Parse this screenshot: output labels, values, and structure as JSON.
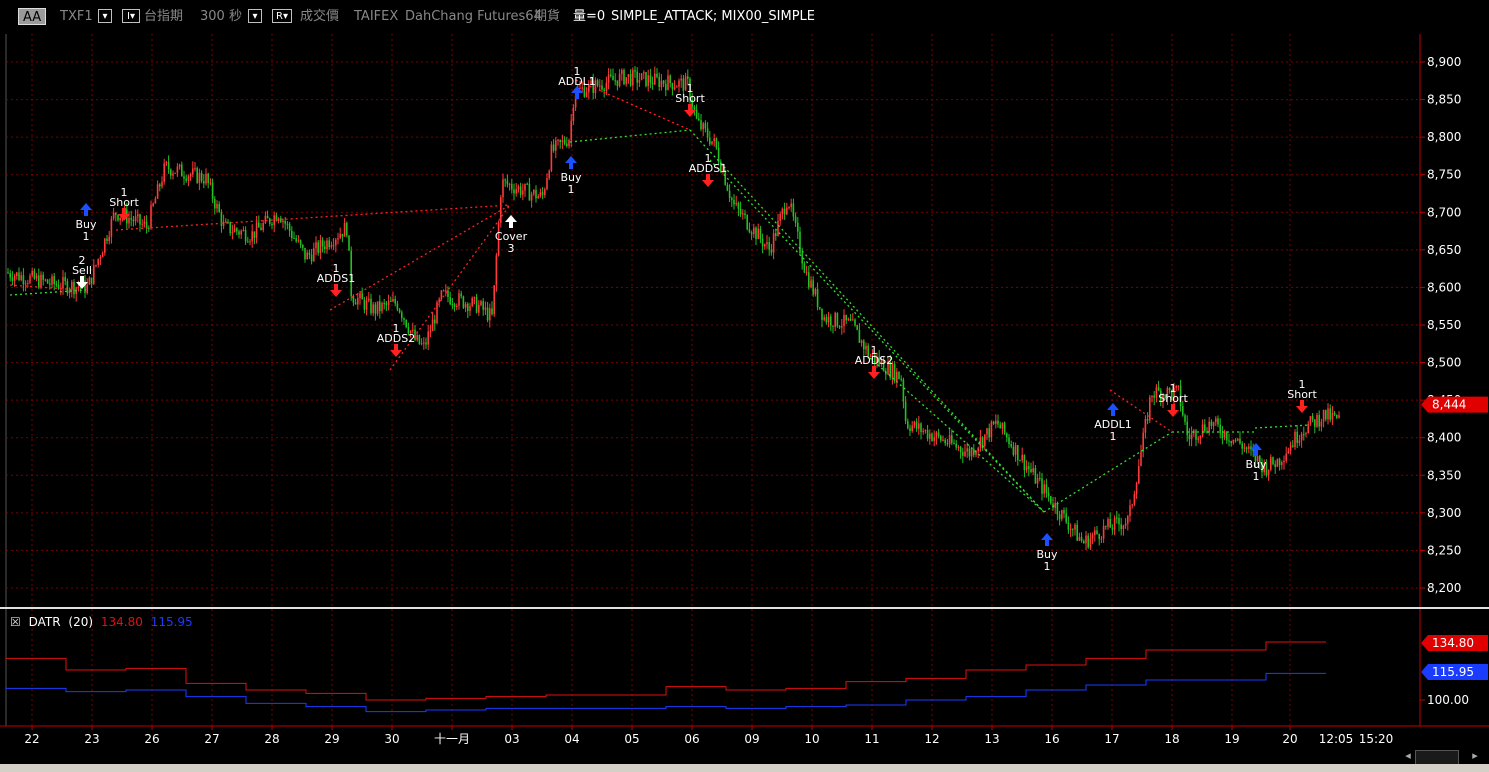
{
  "toolbar": {
    "preset": "AA",
    "symbol": "TXF1",
    "btn1": "▾",
    "btn2": "I▾",
    "name": "台指期",
    "interval": "300 秒",
    "btn3": "▾",
    "btn4": "R▾",
    "price_type": "成交價",
    "exchange": "TAIFEX",
    "broker": "DahChang Futures64",
    "market": "期貨",
    "volume": "量=0",
    "strategy": "SIMPLE_ATTACK; MIX00_SIMPLE"
  },
  "colors": {
    "background": "#000000",
    "grid": "#7a0000",
    "axis_red": "#c00000",
    "candle_up": "#ff3a3a",
    "candle_down": "#22c022",
    "trail_red": "#ff2020",
    "trail_green": "#30e030",
    "atr_red": "#e01010",
    "atr_blue": "#1a3cff"
  },
  "price_axis": {
    "ticks": [
      "8,900",
      "8,850",
      "8,800",
      "8,750",
      "8,700",
      "8,650",
      "8,600",
      "8,550",
      "8,500",
      "8,450",
      "8,400",
      "8,350",
      "8,300",
      "8,250",
      "8,200"
    ],
    "current_label": "8,444",
    "current_value": 8444
  },
  "indicator": {
    "close_icon": "☒",
    "name": "DATR",
    "param": "(20)",
    "value_red": "134.80",
    "value_blue": "115.95",
    "axis_tick": "100.00",
    "tag_red": "134.80",
    "tag_blue": "115.95"
  },
  "dates": [
    "22",
    "23",
    "26",
    "27",
    "28",
    "29",
    "30",
    "十一月",
    "03",
    "04",
    "05",
    "06",
    "09",
    "10",
    "11",
    "12",
    "13",
    "16",
    "17",
    "18",
    "19",
    "20",
    "12:05",
    "15:20"
  ],
  "signals": [
    {
      "label": "Sell",
      "qty": "2",
      "dir": "sell"
    },
    {
      "label": "Buy",
      "qty": "1",
      "dir": "buy"
    },
    {
      "label": "Short",
      "qty": "1",
      "dir": "short"
    },
    {
      "label": "ADDS1",
      "qty": "1",
      "dir": "short"
    },
    {
      "label": "ADDS2",
      "qty": "1",
      "dir": "short"
    },
    {
      "label": "Cover",
      "qty": "3",
      "dir": "cover"
    },
    {
      "label": "Buy",
      "qty": "1",
      "dir": "buy"
    },
    {
      "label": "ADDL1",
      "qty": "1",
      "dir": "buy"
    },
    {
      "label": "Short",
      "qty": "1",
      "dir": "short"
    },
    {
      "label": "ADDS1",
      "qty": "1",
      "dir": "short"
    },
    {
      "label": "ADDS2",
      "qty": "1",
      "dir": "short"
    },
    {
      "label": "Buy",
      "qty": "1",
      "dir": "buy"
    },
    {
      "label": "ADDL1",
      "qty": "1",
      "dir": "buy"
    },
    {
      "label": "Short",
      "qty": "1",
      "dir": "short"
    },
    {
      "label": "Buy",
      "qty": "1",
      "dir": "buy"
    },
    {
      "label": "Short",
      "qty": "1",
      "dir": "short"
    }
  ],
  "chart_data": {
    "type": "candlestick",
    "price_range": [
      8190,
      8920
    ],
    "price_path": [
      [
        0,
        8620
      ],
      [
        0.5,
        8605
      ],
      [
        0.9,
        8600
      ],
      [
        1.2,
        8700
      ],
      [
        1.4,
        8690
      ],
      [
        1.55,
        8680
      ],
      [
        1.75,
        8760
      ],
      [
        2.2,
        8745
      ],
      [
        2.4,
        8680
      ],
      [
        2.7,
        8670
      ],
      [
        3.0,
        8700
      ],
      [
        3.3,
        8640
      ],
      [
        3.75,
        8680
      ],
      [
        3.8,
        8590
      ],
      [
        4.05,
        8570
      ],
      [
        4.3,
        8580
      ],
      [
        4.5,
        8530
      ],
      [
        4.6,
        8520
      ],
      [
        4.8,
        8590
      ],
      [
        5.2,
        8575
      ],
      [
        5.35,
        8560
      ],
      [
        5.45,
        8740
      ],
      [
        5.9,
        8720
      ],
      [
        6.0,
        8780
      ],
      [
        6.2,
        8800
      ],
      [
        6.25,
        8860
      ],
      [
        6.8,
        8880
      ],
      [
        7.5,
        8870
      ],
      [
        7.6,
        8820
      ],
      [
        7.8,
        8790
      ],
      [
        8.0,
        8710
      ],
      [
        8.4,
        8650
      ],
      [
        8.6,
        8720
      ],
      [
        8.8,
        8620
      ],
      [
        9.0,
        8560
      ],
      [
        9.3,
        8550
      ],
      [
        9.5,
        8510
      ],
      [
        9.85,
        8480
      ],
      [
        9.9,
        8420
      ],
      [
        10.6,
        8380
      ],
      [
        10.9,
        8420
      ],
      [
        11.3,
        8350
      ],
      [
        11.6,
        8300
      ],
      [
        11.85,
        8260
      ],
      [
        12.1,
        8280
      ],
      [
        12.35,
        8290
      ],
      [
        12.5,
        8390
      ],
      [
        12.6,
        8460
      ],
      [
        12.9,
        8460
      ],
      [
        13.0,
        8400
      ],
      [
        13.25,
        8420
      ],
      [
        13.6,
        8390
      ],
      [
        13.85,
        8360
      ],
      [
        14.0,
        8370
      ],
      [
        14.25,
        8410
      ],
      [
        14.5,
        8430
      ],
      [
        14.75,
        8420
      ],
      [
        15.0,
        8440
      ]
    ],
    "series": [
      {
        "name": "DATR",
        "values_red": [
          125,
          118,
          119,
          110,
          106,
          104,
          100,
          101,
          102,
          103,
          103,
          108,
          106,
          107,
          111,
          113,
          118,
          121,
          125,
          130,
          130,
          134.8
        ],
        "values_blue": [
          107,
          105,
          106,
          102,
          98,
          96,
          93,
          94,
          95,
          95,
          95,
          96,
          95,
          96,
          97,
          100,
          102,
          106,
          109,
          112,
          112,
          115.95
        ]
      }
    ]
  }
}
